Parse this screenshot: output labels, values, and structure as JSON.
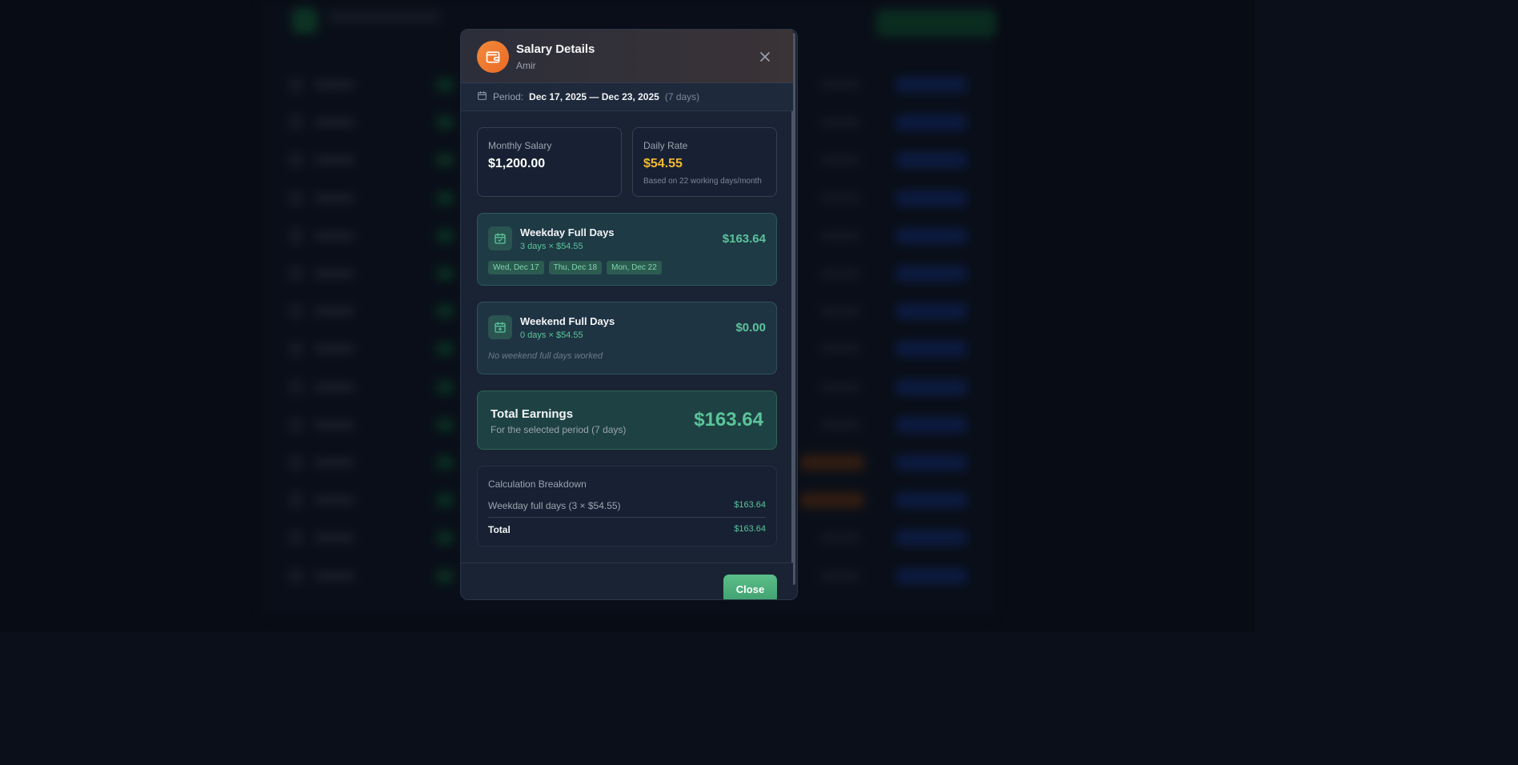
{
  "modal": {
    "title": "Salary Details",
    "employee": "Amir",
    "period": {
      "label": "Period:",
      "range": "Dec 17, 2025 — Dec 23, 2025",
      "days": "(7 days)"
    },
    "monthly_salary": {
      "label": "Monthly Salary",
      "value": "$1,200.00"
    },
    "daily_rate": {
      "label": "Daily Rate",
      "value": "$54.55",
      "note": "Based on 22 working days/month"
    },
    "weekday": {
      "title": "Weekday Full Days",
      "formula": "3 days × $54.55",
      "amount": "$163.64",
      "dates": [
        "Wed, Dec 17",
        "Thu, Dec 18",
        "Mon, Dec 22"
      ]
    },
    "weekend": {
      "title": "Weekend Full Days",
      "formula": "0 days × $54.55",
      "amount": "$0.00",
      "empty_text": "No weekend full days worked"
    },
    "total": {
      "title": "Total Earnings",
      "subtitle": "For the selected period (7 days)",
      "amount": "$163.64"
    },
    "breakdown": {
      "title": "Calculation Breakdown",
      "row_label": "Weekday full days (3 × $54.55)",
      "row_value": "$163.64",
      "total_label": "Total",
      "total_value": "$163.64"
    },
    "close_button": "Close"
  },
  "colors": {
    "accent_green": "#5bc49a",
    "daily_rate": "#f5b82e",
    "icon_orange": "#ea6a24"
  },
  "icons": {
    "header": "wallet-icon",
    "close": "close-icon",
    "period": "calendar-icon",
    "weekday": "calendar-check-icon",
    "weekend": "calendar-plus-icon"
  }
}
